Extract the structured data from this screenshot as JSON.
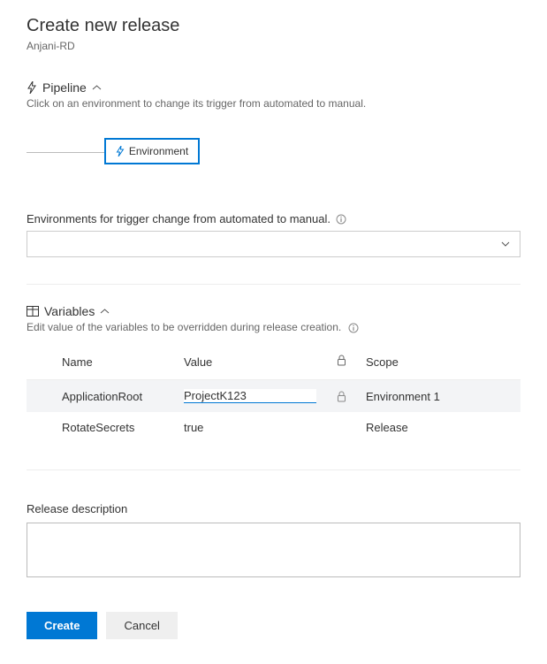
{
  "header": {
    "title": "Create new release",
    "subtitle": "Anjani-RD"
  },
  "pipeline": {
    "label": "Pipeline",
    "desc": "Click on an environment to change its trigger from automated to manual.",
    "env_box_label": "Environment"
  },
  "env_trigger": {
    "label": "Environments for trigger change from automated to manual."
  },
  "variables": {
    "label": "Variables",
    "desc": "Edit value of the variables to be overridden during release creation.",
    "cols": {
      "name": "Name",
      "value": "Value",
      "scope": "Scope"
    },
    "rows": [
      {
        "name": "ApplicationRoot",
        "value": "ProjectK123",
        "locked": true,
        "scope": "Environment 1",
        "active": true
      },
      {
        "name": "RotateSecrets",
        "value": "true",
        "locked": false,
        "scope": "Release",
        "active": false
      }
    ]
  },
  "desc": {
    "label": "Release description"
  },
  "actions": {
    "create": "Create",
    "cancel": "Cancel"
  }
}
